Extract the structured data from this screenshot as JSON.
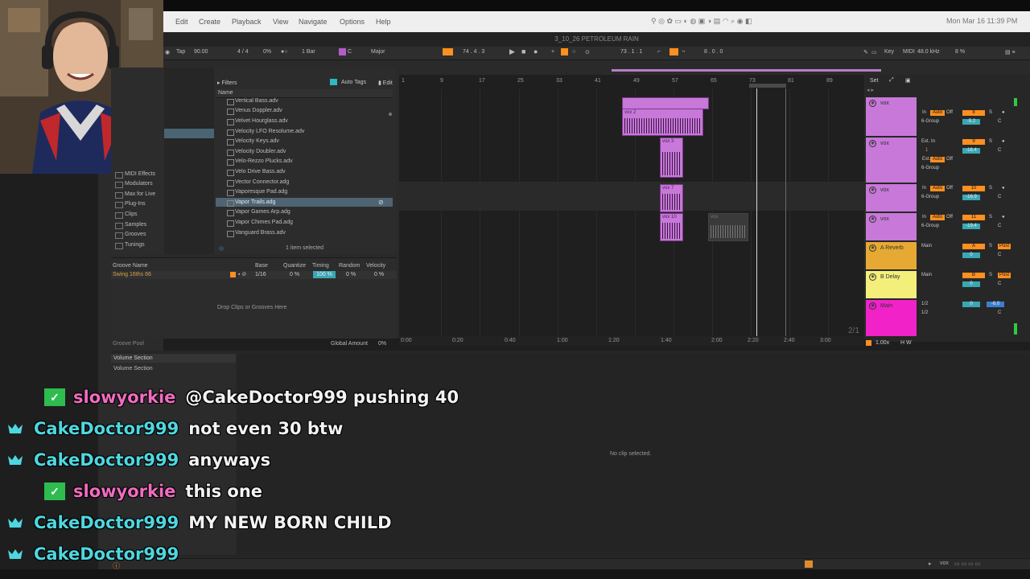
{
  "menubar": {
    "items": [
      "Edit",
      "Create",
      "Playback",
      "View",
      "Navigate",
      "Options",
      "Help"
    ],
    "clock": "Mon Mar 16  11:39 PM"
  },
  "window": {
    "title": "3_10_26 PETROLEUM RAIN"
  },
  "transport": {
    "tap": "Tap",
    "tempo": "90.00",
    "signature": "4 / 4",
    "groove_pct": "0%",
    "quantize": "1 Bar",
    "key": "C",
    "scale": "Major",
    "position": "74 .  4 .  3",
    "loop_start": "73 .  1 .  1",
    "loop_len": "8 .  0 .  0",
    "key_label": "Key",
    "midi_label": "MIDI",
    "sample_rate": "48.0 kHz",
    "cpu": "8 %"
  },
  "browser": {
    "filters_label": "Filters",
    "auto_tags_label": "Auto Tags",
    "edit_label": "Edit",
    "name_header": "Name",
    "selected_count": "1 item selected",
    "items": [
      "Vertical Bass.adv",
      "Venus Doppler.adv",
      "Velvet Hourglass.adv",
      "Velocity LFO Resolume.adv",
      "Velocity Keys.adv",
      "Velocity Doubler.adv",
      "Velo-Rezzo Plucks.adv",
      "Velo Drive Bass.adv",
      "Vector Connector.adg",
      "Vaporesque Pad.adg",
      "Vapor Trails.adg",
      "Vapor Games Arp.adg",
      "Vapor Chimes Pad.adg",
      "Vanguard Brass.adv"
    ],
    "places": [
      "MIDI Effects",
      "Modulators",
      "Max for Live",
      "Plug-Ins",
      "Clips",
      "Samples",
      "Grooves",
      "Tunings"
    ]
  },
  "groove": {
    "headers": [
      "Groove Name",
      "Base",
      "Quantize",
      "Timing",
      "Random",
      "Velocity"
    ],
    "row": {
      "name": "Swing 16ths 66",
      "base": "1/16",
      "quantize": "0 %",
      "timing": "100 %",
      "random": "0 %",
      "velocity": "0 %"
    },
    "drop_hint": "Drop Clips or Grooves Here",
    "pool_label": "Groove Pool",
    "global_amount_label": "Global Amount",
    "global_amount_value": "0%"
  },
  "arrangement": {
    "bars": [
      "1",
      "9",
      "17",
      "25",
      "33",
      "41",
      "49",
      "57",
      "65",
      "73",
      "81",
      "89"
    ],
    "times": [
      "0:00",
      "0:20",
      "0:40",
      "1:00",
      "1:20",
      "1:40",
      "2:00",
      "2:20",
      "2:40",
      "3:00"
    ],
    "clips": [
      {
        "label": "vox 2"
      },
      {
        "label": "vox 3"
      },
      {
        "label": "vox 7"
      },
      {
        "label": "vox 10"
      },
      {
        "label": "vox"
      }
    ],
    "page": "2/1",
    "zoom": "1.00x"
  },
  "mixer": {
    "set_label": "Set",
    "tracks": [
      {
        "name": "vox",
        "in": "In",
        "auto": "Auto",
        "off": "Off",
        "num": "8",
        "group": "6-Group",
        "vol": "-5.2",
        "pan": "C",
        "color": "#c778d8"
      },
      {
        "name": "vox",
        "in": "Ext. In",
        "sub": "1",
        "auto": "Auto",
        "off": "Off",
        "num": "9",
        "group": "6-Group",
        "vol": "-16.4",
        "pan": "C",
        "color": "#c778d8"
      },
      {
        "name": "vox",
        "in": "In",
        "auto": "Auto",
        "off": "Off",
        "num": "10",
        "group": "6-Group",
        "vol": "-16.9",
        "pan": "C",
        "color": "#c778d8"
      },
      {
        "name": "vox",
        "in": "In",
        "auto": "Auto",
        "off": "Off",
        "num": "11",
        "group": "6-Group",
        "vol": "-19.4",
        "pan": "C",
        "color": "#c778d8"
      },
      {
        "name": "A Reverb",
        "out": "Main",
        "num": "A",
        "vol": "0",
        "pan": "C",
        "post": "Post",
        "color": "#e6a933"
      },
      {
        "name": "B Delay",
        "out": "Main",
        "num": "B",
        "vol": "0",
        "pan": "C",
        "post": "Post",
        "color": "#f3ef7a"
      },
      {
        "name": "Main",
        "cue": "1/2",
        "out": "1/2",
        "vol": "0",
        "pan": "C",
        "peak": "-6.0",
        "color": "#f022c8"
      }
    ]
  },
  "lower": {
    "volume_section": "Volume Section",
    "no_clip": "No clip selected.",
    "status_track": "vox"
  },
  "chat": [
    {
      "user": "slowyorkie",
      "msg": "@CakeDoctor999 pushing 40",
      "badge": "check-badge-icon",
      "color": "#f06cc0"
    },
    {
      "user": "CakeDoctor999",
      "msg": "not even 30 btw",
      "badge": "crown-badge-icon",
      "color": "#4fd7e0"
    },
    {
      "user": "CakeDoctor999",
      "msg": "anyways",
      "badge": "crown-badge-icon",
      "color": "#4fd7e0"
    },
    {
      "user": "slowyorkie",
      "msg": "this one",
      "badge": "check-badge-icon",
      "color": "#f06cc0"
    },
    {
      "user": "CakeDoctor999",
      "msg": "MY NEW BORN CHILD",
      "badge": "crown-badge-icon",
      "color": "#4fd7e0"
    },
    {
      "user": "CakeDoctor999",
      "msg": "",
      "badge": "crown-badge-icon",
      "color": "#4fd7e0"
    }
  ]
}
